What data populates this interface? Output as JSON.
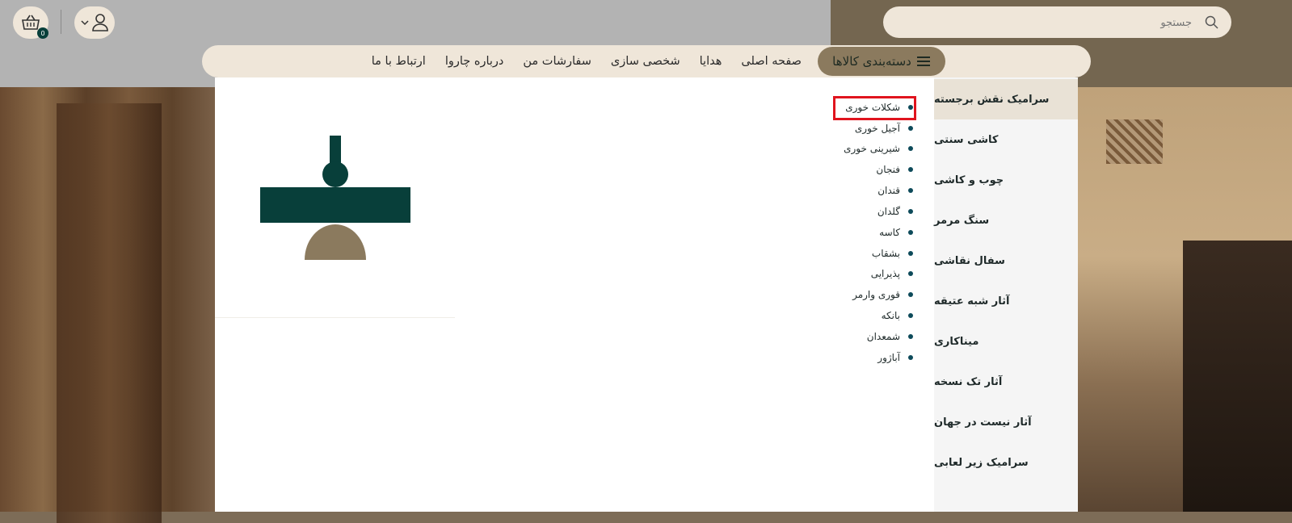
{
  "search": {
    "placeholder": "جستجو"
  },
  "cart": {
    "count": "0"
  },
  "nav": {
    "categories_label": "دسته‌بندی کالاها",
    "links": [
      "صفحه اصلی",
      "هدایا",
      "شخصی سازی",
      "سفارشات من",
      "درباره چاروا",
      "ارتباط با ما"
    ]
  },
  "side_menu": {
    "items": [
      "سرامیک نقش برجسته",
      "کاشی سنتی",
      "چوب و کاشی",
      "سنگ مرمر",
      "سفال نقاشی",
      "آثار شبه عتیقه",
      "میناکاری",
      "آثار تک نسخه",
      "آثار نیست در جهان",
      "سرامیک زیر لعابی"
    ]
  },
  "sub_menu": {
    "items": [
      "شکلات خوری",
      "آجیل خوری",
      "شیرینی خوری",
      "فنجان",
      "قندان",
      "گلدان",
      "کاسه",
      "بشقاب",
      "پذیرایی",
      "قوری وارمر",
      "بانکه",
      "شمعدان",
      "آباژور"
    ]
  },
  "colors": {
    "accent": "#083f3a",
    "brand_tan": "#8b7a5e",
    "cream": "#efe6d9",
    "highlight": "#e0141e"
  }
}
